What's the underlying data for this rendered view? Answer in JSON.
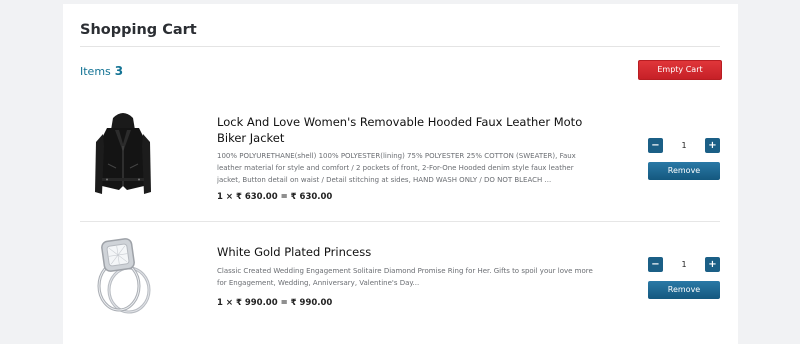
{
  "cart": {
    "title": "Shopping Cart",
    "items_label": "Items",
    "items_count": "3",
    "empty_label": "Empty Cart"
  },
  "products": [
    {
      "image": "black-hooded-leather-jacket",
      "title": "Lock And Love Women's Removable Hooded Faux Leather Moto Biker Jacket",
      "description": "100% POLYURETHANE(shell) 100% POLYESTER(lining) 75% POLYESTER 25% COTTON (SWEATER), Faux leather material for style and comfort / 2 pockets of front, 2-For-One Hooded denim style faux leather jacket, Button detail on waist / Detail stitching at sides, HAND WASH ONLY / DO NOT BLEACH ...",
      "price_line": "1 × ₹ 630.00 = ₹ 630.00",
      "quantity": "1",
      "remove_label": "Remove"
    },
    {
      "image": "diamond-ring-set",
      "title": "White Gold Plated Princess",
      "description": "Classic Created Wedding Engagement Solitaire Diamond Promise Ring for Her. Gifts to spoil your love more for Engagement, Wedding, Anniversary, Valentine's Day...",
      "price_line": "1 × ₹ 990.00 = ₹ 990.00",
      "quantity": "1",
      "remove_label": "Remove"
    }
  ],
  "controls": {
    "minus": "−",
    "plus": "+"
  }
}
